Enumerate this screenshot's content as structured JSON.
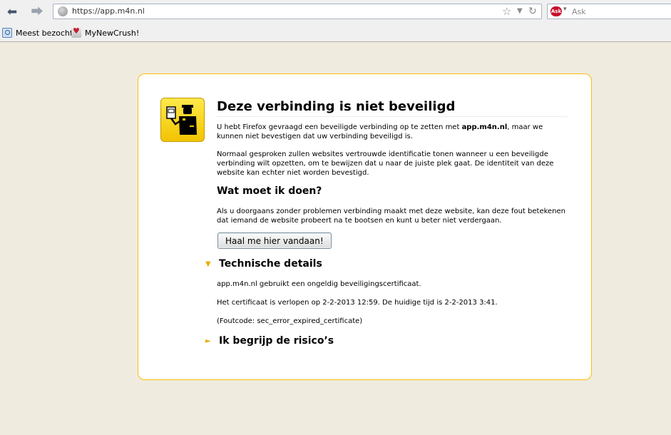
{
  "browser": {
    "url": "https://app.m4n.nl",
    "search_placeholder": "Ask",
    "search_engine_logo": "Ask",
    "bookmarks": [
      {
        "label": "Meest bezocht",
        "icon": "most-visited-folder-icon"
      },
      {
        "label": "MyNewCrush!",
        "icon": "mynewcrush-favicon"
      }
    ]
  },
  "error": {
    "title": "Deze verbinding is niet beveiligd",
    "intro_before": "U hebt Firefox gevraagd een beveiligde verbinding op te zetten met ",
    "intro_host": "app.m4n.nl",
    "intro_after": ", maar we kunnen niet bevestigen dat uw verbinding beveiligd is.",
    "normal": "Normaal gesproken zullen websites vertrouwde identificatie tonen wanneer u een beveiligde verbinding wilt opzetten, om te bewijzen dat u naar de juiste plek gaat. De identiteit van deze website kan echter niet worden bevestigd.",
    "what_to_do_heading": "Wat moet ik doen?",
    "what_to_do_text": "Als u doorgaans zonder problemen verbinding maakt met deze website, kan deze fout betekenen dat iemand de website probeert na te bootsen en kunt u beter niet verdergaan.",
    "get_me_out_button": "Haal me hier vandaan!",
    "technical_heading": "Technische details",
    "tech_line1": "app.m4n.nl gebruikt een ongeldig beveiligingscertificaat.",
    "tech_line2": "Het certificaat is verlopen op 2-2-2013 12:59. De huidige tijd is 2-2-2013 3:41.",
    "tech_line3": "(Foutcode: sec_error_expired_certificate)",
    "risks_heading": "Ik begrijp de risico’s",
    "expander_open_glyph": "▼",
    "expander_closed_glyph": "►"
  },
  "colors": {
    "page_bg": "#efebde",
    "box_border": "#ffbd09",
    "icon_yellow": "#f2c400"
  }
}
